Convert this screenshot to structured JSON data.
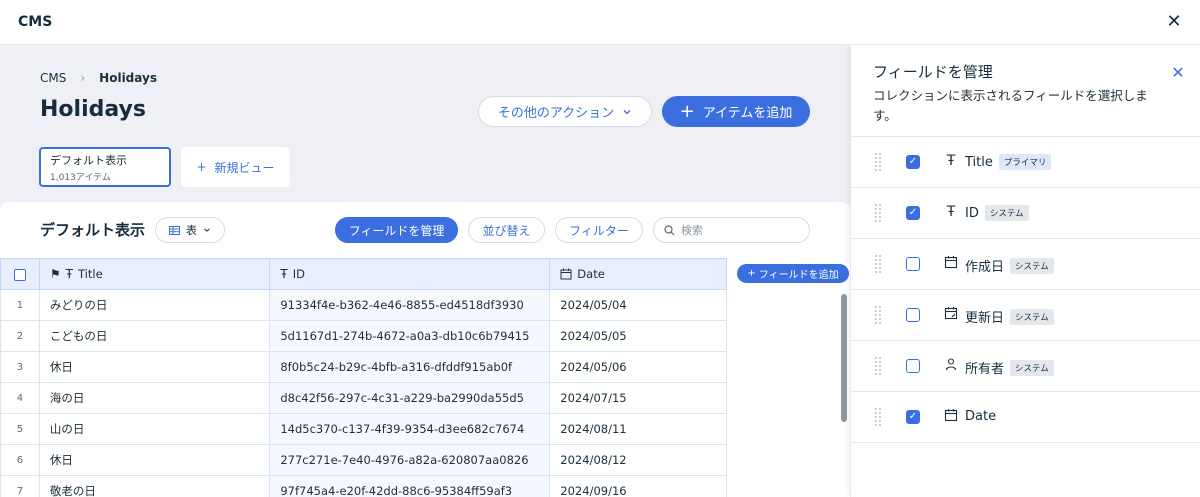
{
  "app": {
    "title": "CMS"
  },
  "breadcrumb": {
    "root": "CMS",
    "current": "Holidays"
  },
  "page": {
    "title": "Holidays"
  },
  "actions": {
    "more_label": "その他のアクション",
    "add_item_label": "アイテムを追加"
  },
  "views": {
    "active": {
      "name": "デフォルト表示",
      "count": "1,013アイテム"
    },
    "new_view_label": "新規ビュー"
  },
  "toolbar": {
    "section_title": "デフォルト表示",
    "view_type": "表",
    "manage_fields": "フィールドを管理",
    "sort": "並び替え",
    "filter": "フィルター",
    "search_placeholder": "検索"
  },
  "table": {
    "columns": [
      "Title",
      "ID",
      "Date"
    ],
    "add_field_label": "フィールドを追加",
    "rows": [
      {
        "num": "1",
        "title": "みどりの日",
        "id": "91334f4e-b362-4e46-8855-ed4518df3930",
        "date": "2024/05/04"
      },
      {
        "num": "2",
        "title": "こどもの日",
        "id": "5d1167d1-274b-4672-a0a3-db10c6b79415",
        "date": "2024/05/05"
      },
      {
        "num": "3",
        "title": "休日",
        "id": "8f0b5c24-b29c-4bfb-a316-dfddf915ab0f",
        "date": "2024/05/06"
      },
      {
        "num": "4",
        "title": "海の日",
        "id": "d8c42f56-297c-4c31-a229-ba2990da55d5",
        "date": "2024/07/15"
      },
      {
        "num": "5",
        "title": "山の日",
        "id": "14d5c370-c137-4f39-9354-d3ee682c7674",
        "date": "2024/08/11"
      },
      {
        "num": "6",
        "title": "休日",
        "id": "277c271e-7e40-4976-a82a-620807aa0826",
        "date": "2024/08/12"
      },
      {
        "num": "7",
        "title": "敬老の日",
        "id": "97f745a4-e20f-42dd-88c6-95384ff59af3",
        "date": "2024/09/16"
      }
    ]
  },
  "panel": {
    "title": "フィールドを管理",
    "subtitle": "コレクションに表示されるフィールドを選択します。",
    "fields": [
      {
        "name": "Title",
        "tag": "プライマリ",
        "icon": "text-icon",
        "checked": true
      },
      {
        "name": "ID",
        "tag": "システム",
        "icon": "text-icon",
        "checked": true
      },
      {
        "name": "作成日",
        "tag": "システム",
        "icon": "calendar-icon",
        "checked": false
      },
      {
        "name": "更新日",
        "tag": "システム",
        "icon": "calendar-edit-icon",
        "checked": false
      },
      {
        "name": "所有者",
        "tag": "システム",
        "icon": "person-icon",
        "checked": false
      },
      {
        "name": "Date",
        "tag": "",
        "icon": "calendar-icon",
        "checked": true
      }
    ]
  },
  "colors": {
    "accent": "#3b6fe0",
    "header_bg": "#e7efff",
    "main_bg": "#eef0f5"
  }
}
